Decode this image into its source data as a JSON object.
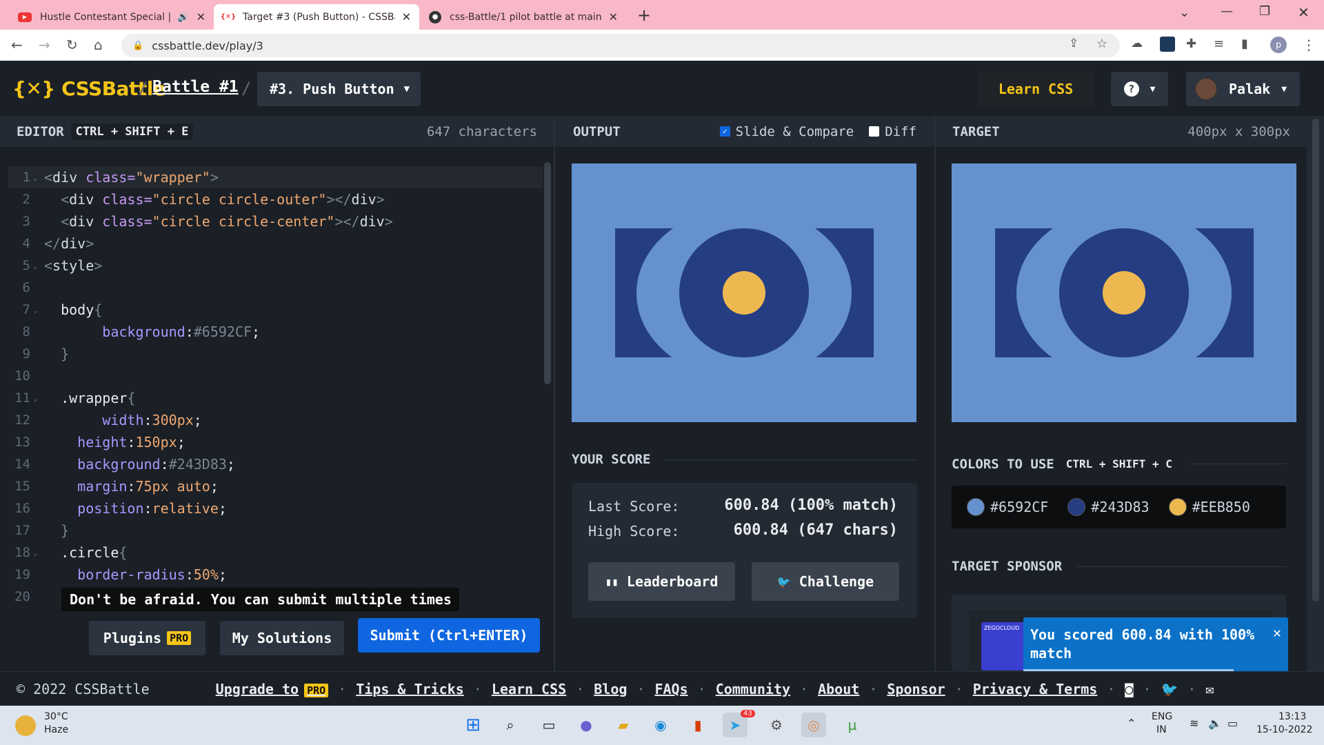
{
  "browser": {
    "tabs": [
      {
        "title": "Hustle Contestant Special | K",
        "icon": "youtube-icon"
      },
      {
        "title": "Target #3 (Push Button) - CSSBat",
        "icon": "cssbattle-icon"
      },
      {
        "title": "css-Battle/1 pilot battle at main ·",
        "icon": "github-icon"
      }
    ],
    "url": "cssbattle.dev/play/3"
  },
  "header": {
    "logo": "{✕} CSSBattle",
    "battle": "Battle #1",
    "target_selector": "#3. Push Button",
    "learn_css": "Learn CSS",
    "user": "Palak"
  },
  "editor": {
    "title": "EDITOR",
    "shortcut": "CTRL + SHIFT + E",
    "char_count": "647 characters",
    "tooltip": "Don't be afraid. You can submit multiple times",
    "plugins_label": "Plugins",
    "pro_badge": "PRO",
    "solutions_label": "My Solutions",
    "submit_label": "Submit (Ctrl+ENTER)"
  },
  "code_lines": [
    {
      "n": "1",
      "fold": true
    },
    {
      "n": "2"
    },
    {
      "n": "3"
    },
    {
      "n": "4"
    },
    {
      "n": "5",
      "fold": true
    },
    {
      "n": "6"
    },
    {
      "n": "7",
      "fold": true
    },
    {
      "n": "8"
    },
    {
      "n": "9"
    },
    {
      "n": "10"
    },
    {
      "n": "11",
      "fold": true
    },
    {
      "n": "12"
    },
    {
      "n": "13"
    },
    {
      "n": "14"
    },
    {
      "n": "15"
    },
    {
      "n": "16"
    },
    {
      "n": "17"
    },
    {
      "n": "18",
      "fold": true
    },
    {
      "n": "19"
    },
    {
      "n": "20"
    }
  ],
  "code_text": {
    "l1": [
      "<",
      "div",
      " class=",
      "\"wrapper\"",
      ">"
    ],
    "l2": [
      "  <",
      "div",
      " class=",
      "\"circle circle-outer\"",
      "></",
      "div",
      ">"
    ],
    "l3": [
      "  <",
      "div",
      " class=",
      "\"circle circle-center\"",
      "></",
      "div",
      ">"
    ],
    "l4": [
      "</",
      "div",
      ">"
    ],
    "l5": [
      "<",
      "style",
      ">"
    ],
    "l7": [
      "  body",
      "{"
    ],
    "l8": [
      "       background",
      ":",
      "#6592CF",
      ";"
    ],
    "l9": [
      "  }"
    ],
    "l11": [
      "  .wrapper",
      "{"
    ],
    "l12": [
      "       width",
      ":",
      "300px",
      ";"
    ],
    "l13": [
      "    height",
      ":",
      "150px",
      ";"
    ],
    "l14": [
      "    background",
      ":",
      "#243D83",
      ";"
    ],
    "l15": [
      "    margin",
      ":",
      "75px auto",
      ";"
    ],
    "l16": [
      "    position",
      ":",
      "relative",
      ";"
    ],
    "l17": [
      "  }"
    ],
    "l18": [
      "  .circle",
      "{"
    ],
    "l19": [
      "    border-radius",
      ":",
      "50%",
      ";"
    ]
  },
  "output": {
    "title": "OUTPUT",
    "slide_compare": "Slide & Compare",
    "diff": "Diff",
    "score_title": "YOUR SCORE",
    "last_score_label": "Last Score:",
    "last_score_value": "600.84 (100% match)",
    "high_score_label": "High Score:",
    "high_score_value": "600.84 (647 chars)",
    "leaderboard": "Leaderboard",
    "challenge": "Challenge"
  },
  "target": {
    "title": "TARGET",
    "size": "400px x 300px",
    "colors_title": "COLORS TO USE",
    "colors_shortcut": "CTRL + SHIFT + C",
    "colors": [
      "#6592CF",
      "#243D83",
      "#EEB850"
    ],
    "sponsor_title": "TARGET SPONSOR",
    "sponsor_brand": "ZEGOCLOUD"
  },
  "toast": {
    "message": "You scored 600.84 with 100% match",
    "close": "✕"
  },
  "footer": {
    "copyright": "© 2022 CSSBattle",
    "links": [
      "Upgrade to",
      "Tips & Tricks",
      "Learn CSS",
      "Blog",
      "FAQs",
      "Community",
      "About",
      "Sponsor",
      "Privacy & Terms"
    ],
    "pro": "PRO"
  },
  "taskbar": {
    "weather_temp": "30°C",
    "weather_desc": "Haze",
    "lang": "ENG",
    "region": "IN",
    "time": "13:13",
    "date": "15-10-2022",
    "telegram_badge": "43"
  }
}
